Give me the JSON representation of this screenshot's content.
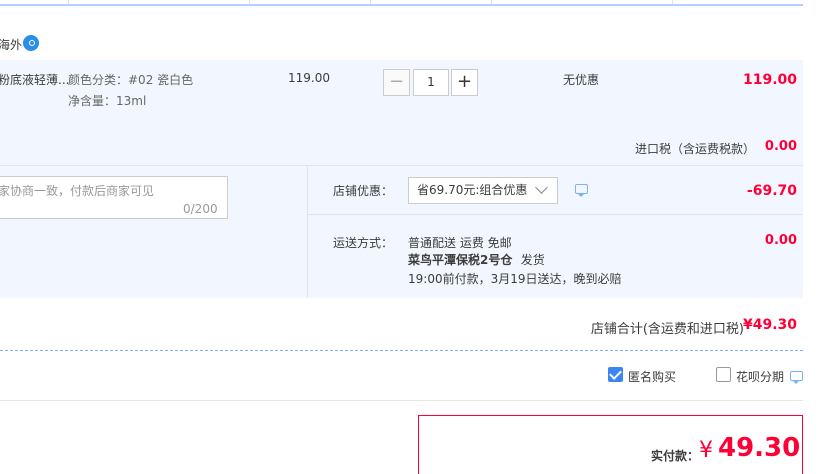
{
  "shop": {
    "tag": "海外"
  },
  "item": {
    "name": "粉底液轻薄...",
    "sku_color": "颜色分类：#02 瓷白色",
    "sku_volume": "净含量：13ml",
    "price": "119.00",
    "quantity": "1",
    "qty_minus": "−",
    "qty_plus": "+",
    "promotion": "无优惠",
    "subtotal": "119.00"
  },
  "tax": {
    "label": "进口税（含运费税款）",
    "value": "0.00"
  },
  "memo": {
    "placeholder": "家协商一致，付款后商家可见",
    "count": "0/200"
  },
  "shop_discount": {
    "label": "店铺优惠：",
    "selected": "省69.70元:组合优惠",
    "value": "-69.70"
  },
  "shipping": {
    "label": "运送方式：",
    "line1": "普通配送 运费 免邮",
    "line2_bold": "菜鸟平潭保税2号仓",
    "line2_rest": "发货",
    "line3": "19:00前付款，3月19日送达，晚到必赔",
    "value": "0.00"
  },
  "shop_total": {
    "label": "店铺合计(含运费和进口税)",
    "value": "¥49.30"
  },
  "options": {
    "anonymous": "匿名购买",
    "huabei": "花呗分期",
    "anonymous_checked": true,
    "huabei_checked": false
  },
  "payment": {
    "label": "实付款：",
    "currency": "¥",
    "amount": "49.30"
  },
  "colors": {
    "accent": "#ff0036",
    "band": "#f2f7ff",
    "checkbox": "#3b86f0"
  }
}
